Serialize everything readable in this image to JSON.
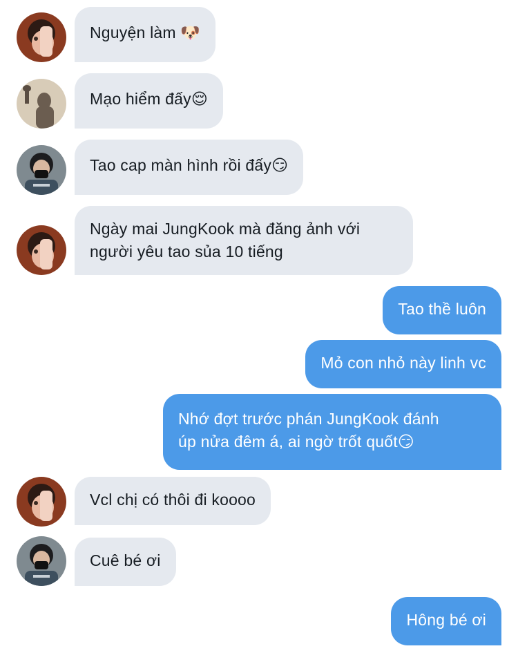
{
  "messages": [
    {
      "direction": "incoming",
      "sender_avatar": "avatar-girl-hand",
      "text": "Nguyện làm 🐶"
    },
    {
      "direction": "incoming",
      "sender_avatar": "avatar-shadow-silhouette",
      "text": "Mạo hiểm đấy😌"
    },
    {
      "direction": "incoming",
      "sender_avatar": "avatar-boy-mask",
      "text": "Tao cap màn hình rồi đấy😏"
    },
    {
      "direction": "incoming",
      "sender_avatar": "avatar-girl-hand",
      "lines": [
        "Ngày mai JungKook mà đăng ảnh với",
        "người yêu tao sủa 10 tiếng"
      ]
    },
    {
      "direction": "outgoing",
      "text": "Tao thề luôn"
    },
    {
      "direction": "outgoing",
      "text": "Mỏ con nhỏ này linh vc"
    },
    {
      "direction": "outgoing",
      "lines": [
        "Nhớ đợt trước phán JungKook đánh",
        "úp nửa đêm á, ai ngờ trốt quốt😏"
      ]
    },
    {
      "direction": "incoming",
      "sender_avatar": "avatar-girl-hand",
      "text": "Vcl chị có thôi đi koooo"
    },
    {
      "direction": "incoming",
      "sender_avatar": "avatar-boy-mask",
      "text": "Cuê bé ơi"
    },
    {
      "direction": "outgoing",
      "text": "Hông bé ơi"
    }
  ],
  "colors": {
    "incoming_bubble": "#e5e9ef",
    "outgoing_bubble": "#4c9ae8",
    "incoming_text": "#161c22",
    "outgoing_text": "#ffffff",
    "background": "#ffffff"
  }
}
